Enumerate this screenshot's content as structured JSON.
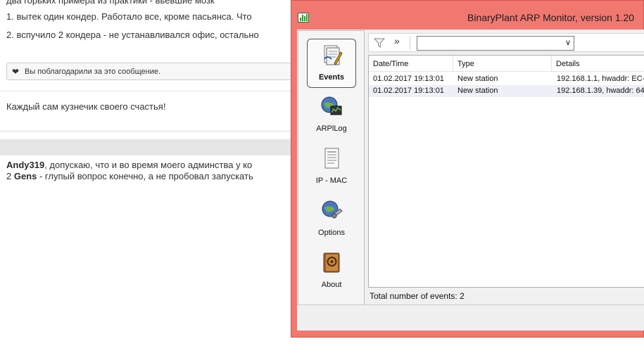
{
  "forum": {
    "top_line": "два горьких примера из практики - вьевшие мозк",
    "line1": "1. вытек один кондер. Работало все, кроме пасьянса. Что",
    "line2": "2. вспучило 2 кондера - не устанавливался офис, остально",
    "thanks_text": "Вы поблагодарили за это сообщение.",
    "signature": "Каждый сам кузнечик своего счастья!",
    "reply1_user": "Andy319",
    "reply1_text": ", допускаю, что и во время моего админства у ко",
    "reply2_prefix": "2 ",
    "reply2_user": "Gens",
    "reply2_text": " - глупый вопрос конечно, а не пробовал запускать"
  },
  "window": {
    "title": "BinaryPlant ARP Monitor, version 1.20"
  },
  "nav": {
    "items": [
      {
        "label": "Events",
        "icon": "events-icon",
        "active": true
      },
      {
        "label": "ARPlLog",
        "icon": "arp-log-icon",
        "active": false
      },
      {
        "label": "IP - MAC",
        "icon": "ip-mac-icon",
        "active": false
      },
      {
        "label": "Options",
        "icon": "options-icon",
        "active": false
      },
      {
        "label": "About",
        "icon": "about-icon",
        "active": false
      }
    ]
  },
  "toolbar": {
    "filter_icon": "filter-icon",
    "more_label": "»",
    "select_value": ""
  },
  "table": {
    "columns": [
      "Date/Time",
      "Type",
      "Details"
    ],
    "rows": [
      [
        "01.02.2017 19:13:01",
        "New station",
        "192.168.1.1, hwaddr: EC-"
      ],
      [
        "01.02.2017 19:13:01",
        "New station",
        "192.168.1.39, hwaddr: 64"
      ]
    ]
  },
  "status": {
    "text": "Total number of events: 2"
  }
}
